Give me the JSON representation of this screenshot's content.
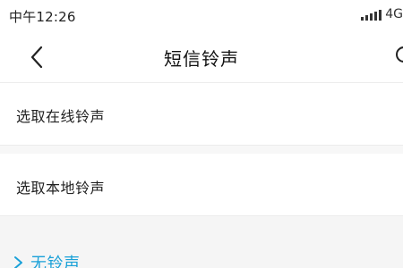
{
  "status_bar": {
    "time": "中午12:26",
    "network": "4G"
  },
  "header": {
    "title": "短信铃声"
  },
  "list": {
    "items": [
      {
        "label": "选取在线铃声"
      },
      {
        "label": "选取本地铃声"
      }
    ]
  },
  "ringtones": {
    "none_label": "无铃声"
  },
  "colors": {
    "accent": "#1aa1d8",
    "background": "#f5f5f5"
  },
  "icons": {
    "back": "chevron-left-icon",
    "search": "search-icon",
    "signal": "signal-strength-icon",
    "expand": "chevron-right-icon"
  }
}
